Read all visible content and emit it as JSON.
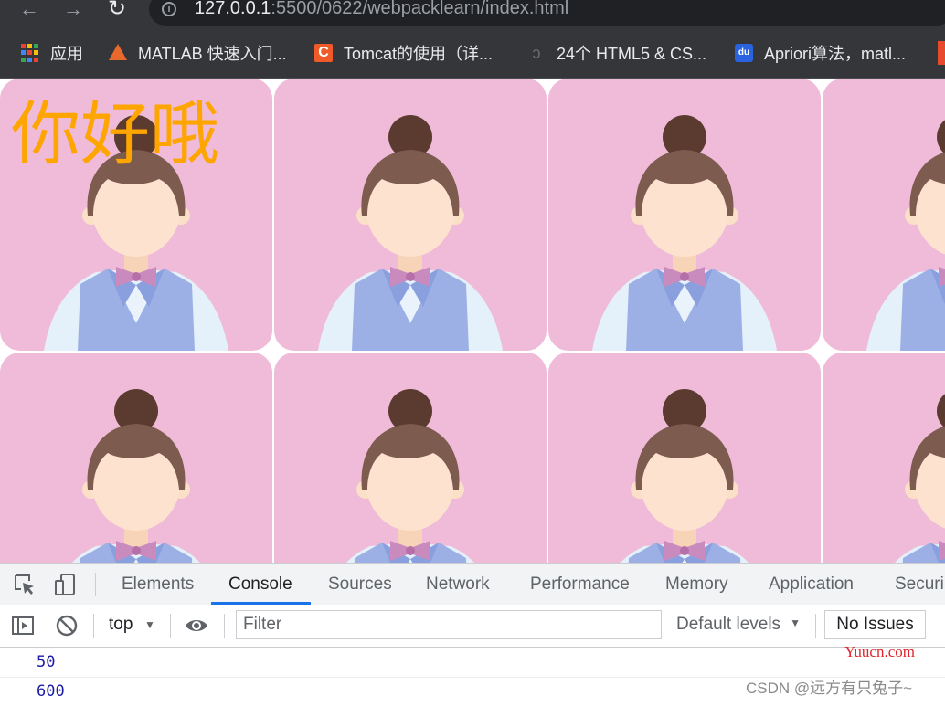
{
  "browser": {
    "url_host": "127.0.0.1",
    "url_rest": ":5500/0622/webpacklearn/index.html",
    "nav": {
      "back": "←",
      "forward": "→",
      "reload": "↻"
    },
    "bookmarks": [
      {
        "label": "应用",
        "icon": "apps-grid-icon"
      },
      {
        "label": "MATLAB 快速入门...",
        "icon": "matlab-icon"
      },
      {
        "label": "Tomcat的使用（详...",
        "icon": "csdn-c-icon"
      },
      {
        "label": "24个 HTML5 & CS...",
        "icon": "feather-icon"
      },
      {
        "label": "Apriori算法，matl...",
        "icon": "baidu-icon"
      }
    ]
  },
  "page": {
    "greeting": "你好哦",
    "tile_image": "cartoon-girl-avatar",
    "colors": {
      "tile_bg": "#efbbd8",
      "greeting": "#ffa500"
    }
  },
  "devtools": {
    "tabs": [
      "Elements",
      "Console",
      "Sources",
      "Network",
      "Performance",
      "Memory",
      "Application",
      "Securi"
    ],
    "active_tab": "Console",
    "toolbar": {
      "context": "top",
      "filter_placeholder": "Filter",
      "levels": "Default levels",
      "issues": "No Issues"
    },
    "console_logs": [
      "50",
      "600"
    ]
  },
  "watermarks": {
    "site": "Yuucn.com",
    "author": "CSDN @远方有只兔子~"
  }
}
